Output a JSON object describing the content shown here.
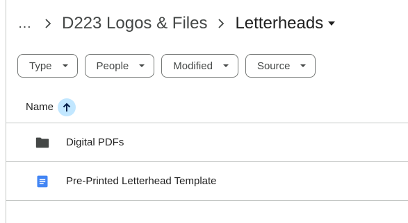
{
  "breadcrumb": {
    "more_label": "…",
    "items": [
      "D223 Logos & Files"
    ],
    "current": "Letterheads"
  },
  "filters": [
    {
      "label": "Type"
    },
    {
      "label": "People"
    },
    {
      "label": "Modified"
    },
    {
      "label": "Source"
    }
  ],
  "columns": {
    "name_label": "Name",
    "sort_icon": "arrow-up-icon"
  },
  "rows": [
    {
      "name": "Digital PDFs",
      "icon": "folder-icon"
    },
    {
      "name": "Pre-Printed Letterhead Template",
      "icon": "google-docs-icon"
    }
  ],
  "colors": {
    "accent": "#0b57d0",
    "sort_bg": "#c2e7ff",
    "docs_blue": "#4285f4",
    "folder": "#444746",
    "divider": "#c4c7c5"
  }
}
